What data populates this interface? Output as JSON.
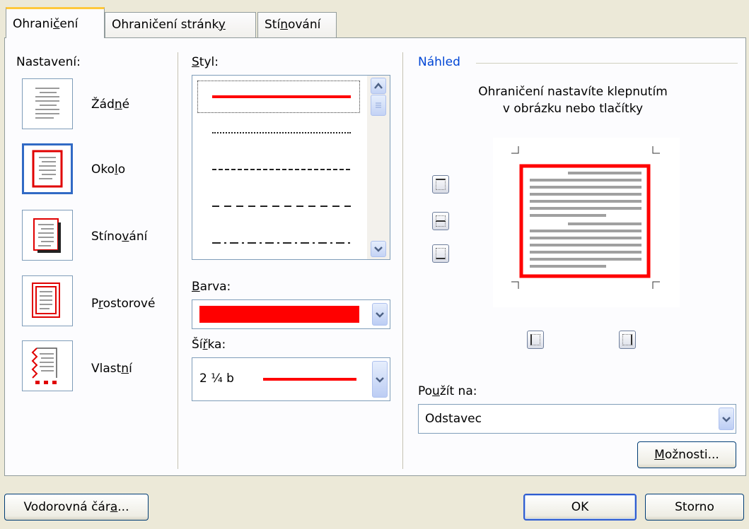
{
  "tabs": [
    {
      "label": "Ohraničení",
      "pre": "Ohrani",
      "key": "č",
      "post": "ení"
    },
    {
      "label": "Ohraničení stránky",
      "pre": "Ohraničení stránk",
      "key": "y",
      "post": ""
    },
    {
      "label": "Stínování",
      "pre": "Stí",
      "key": "n",
      "post": "ování"
    }
  ],
  "setting": {
    "heading": "Nastavení:",
    "options": [
      {
        "label": "Žádné",
        "pre": "Žád",
        "key": "n",
        "post": "é",
        "selected": false
      },
      {
        "label": "Okolo",
        "pre": "Oko",
        "key": "l",
        "post": "o",
        "selected": true
      },
      {
        "label": "Stínování",
        "pre": "Stíno",
        "key": "v",
        "post": "ání",
        "selected": false
      },
      {
        "label": "Prostorové",
        "pre": "P",
        "key": "r",
        "post": "ostorové",
        "selected": false
      },
      {
        "label": "Vlastní",
        "pre": "Vlast",
        "key": "n",
        "post": "í",
        "selected": false
      }
    ]
  },
  "style": {
    "heading_pre": "",
    "heading_key": "S",
    "heading_post": "tyl:",
    "selected_index": 0,
    "line_styles": [
      "solid",
      "dotted",
      "fine-dashed",
      "dashed",
      "dash-dot"
    ]
  },
  "color": {
    "heading_pre": "",
    "heading_key": "B",
    "heading_post": "arva:",
    "value": "#FF0000"
  },
  "width": {
    "heading_pre": "Ší",
    "heading_key": "ř",
    "heading_post": "ka:",
    "value": "2 ¼ b"
  },
  "preview": {
    "heading": "Náhled",
    "hint_line1": "Ohraničení nastavíte klepnutím",
    "hint_line2": "v obrázku nebo tlačítky"
  },
  "apply_to": {
    "label_pre": "Po",
    "label_key": "u",
    "label_post": "žít na:",
    "value": "Odstavec"
  },
  "buttons": {
    "options_pre": "",
    "options_key": "M",
    "options_post": "ožnosti...",
    "horizontal_line_pre": "Vodorovná čár",
    "horizontal_line_key": "a",
    "horizontal_line_post": "...",
    "ok": "OK",
    "cancel": "Storno"
  },
  "colors": {
    "accent_blue": "#0046D5",
    "border_red": "#FF0000",
    "preview_gray": "#A0A0A0"
  }
}
